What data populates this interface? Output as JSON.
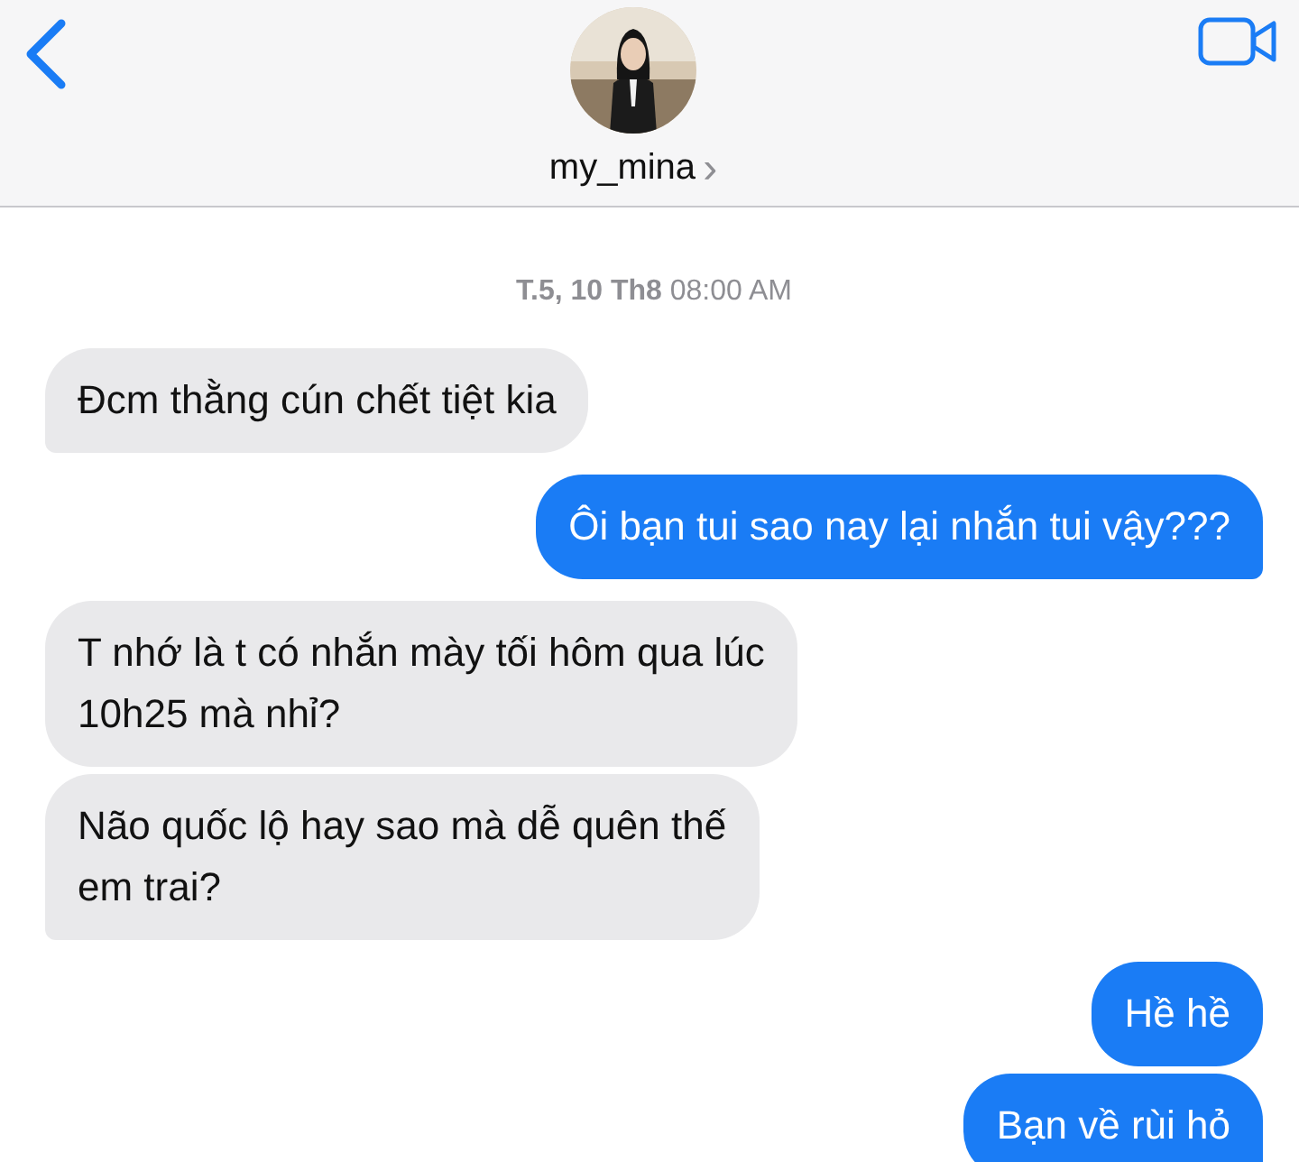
{
  "header": {
    "contact_name": "my_mina",
    "chevron": "›"
  },
  "timestamp": "**T.5, 10 Th8** 08:00 AM",
  "messages": [
    {
      "kind": "received",
      "lines": [
        "Đcm thằng cún chết tiệt kia"
      ],
      "tail": true
    },
    {
      "kind": "sent",
      "lines": [
        "Ôi bạn tui sao nay lại nhắn tui vậy???"
      ],
      "tail": true
    },
    {
      "kind": "received",
      "lines": [
        "T nhớ là t có nhắn mày tối hôm qua lúc",
        "10h25 mà nhỉ?"
      ],
      "tail": false
    },
    {
      "kind": "received",
      "lines": [
        "Não quốc lộ hay sao mà dễ quên thế",
        "em trai?"
      ],
      "tail": true
    },
    {
      "kind": "sent",
      "lines": [
        "Hề hề"
      ],
      "tail": false
    },
    {
      "kind": "sent",
      "lines": [
        "Bạn về rùi hỏ"
      ],
      "tail": true
    }
  ]
}
